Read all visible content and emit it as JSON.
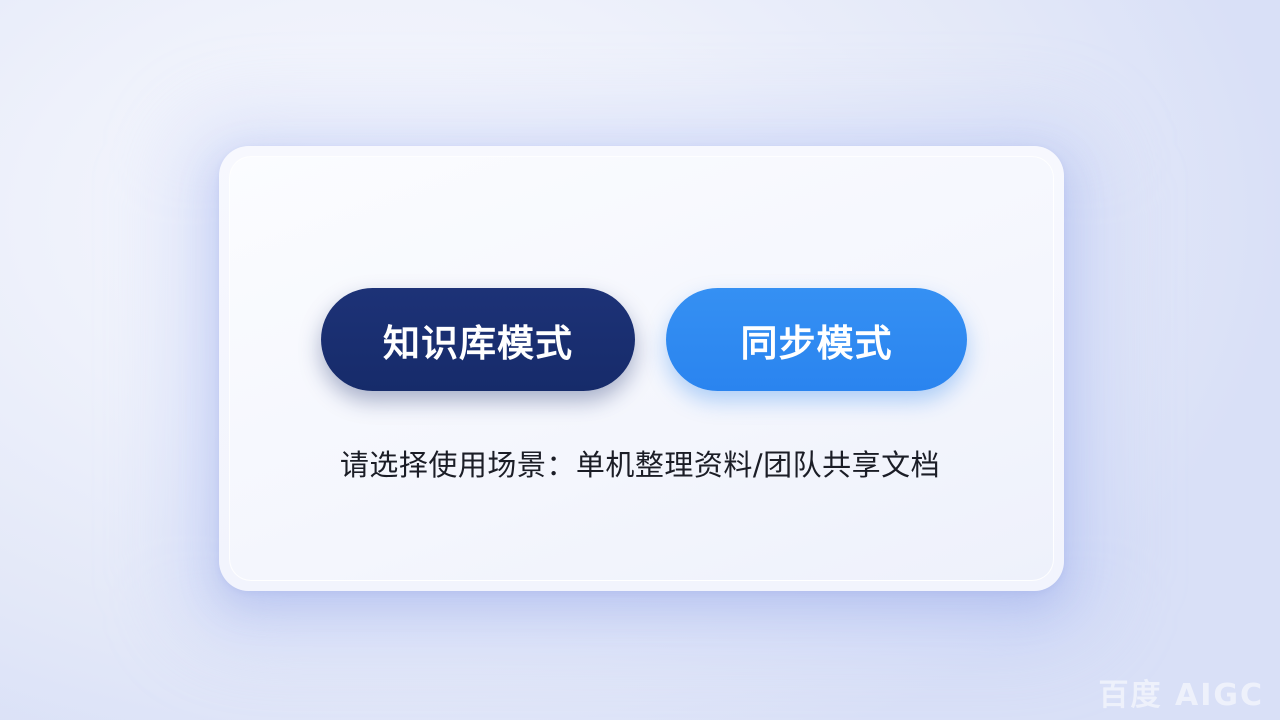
{
  "buttons": {
    "knowledge_mode": "知识库模式",
    "sync_mode": "同步模式"
  },
  "hint_text": "请选择使用场景：单机整理资料/团队共享文档",
  "colors": {
    "knowledge_button": "#162b6a",
    "sync_button": "#2a84ef",
    "background": "#e8ecfa"
  },
  "watermark": "百度 AIGC"
}
